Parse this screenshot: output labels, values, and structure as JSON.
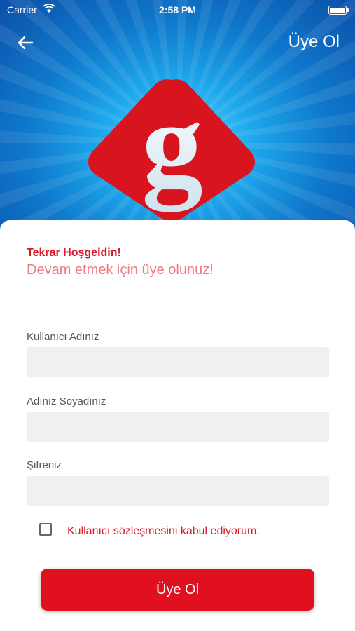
{
  "status_bar": {
    "carrier": "Carrier",
    "time": "2:58 PM"
  },
  "nav": {
    "title": "Üye Ol",
    "back_icon": "arrow-left-icon"
  },
  "logo": {
    "letter": "g",
    "icon": "brand-logo"
  },
  "form": {
    "welcome": "Tekrar Hoşgeldin!",
    "subtitle": "Devam etmek için üye olunuz!",
    "username_label": "Kullanıcı Adınız",
    "username_value": "",
    "fullname_label": "Adınız Soyadınız",
    "fullname_value": "",
    "password_label": "Şifreniz",
    "password_value": "",
    "agreement_label": "Kullanıcı sözleşmesini kabul ediyorum.",
    "agreement_checked": false,
    "submit_label": "Üye Ol"
  },
  "colors": {
    "accent": "#e01020",
    "hero_blue": "#1ea8ec",
    "input_bg": "#f0f0f0"
  }
}
